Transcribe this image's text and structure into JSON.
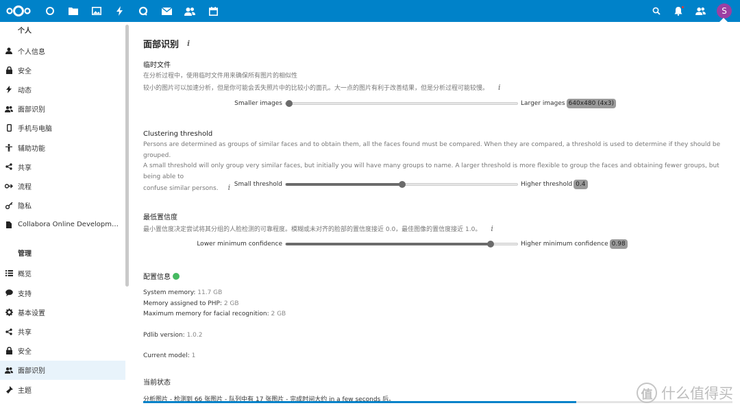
{
  "header": {
    "apps": [
      "dashboard",
      "files",
      "photos",
      "activity",
      "talk",
      "mail",
      "contacts",
      "calendar"
    ],
    "accent": "#0082c9",
    "avatar_letter": "S",
    "avatar_color": "#9b3fa3"
  },
  "sidebar": {
    "personal_heading": "个人",
    "personal_items": [
      {
        "label": "个人信息",
        "icon": "user-icon"
      },
      {
        "label": "安全",
        "icon": "lock-icon"
      },
      {
        "label": "动态",
        "icon": "activity-icon"
      },
      {
        "label": "面部识别",
        "icon": "group-icon"
      },
      {
        "label": "手机与电脑",
        "icon": "phone-icon"
      },
      {
        "label": "辅助功能",
        "icon": "accessibility-icon"
      },
      {
        "label": "共享",
        "icon": "share-icon"
      },
      {
        "label": "流程",
        "icon": "flow-icon"
      },
      {
        "label": "隐私",
        "icon": "privacy-icon"
      },
      {
        "label": "Collabora Online Development E...",
        "icon": "document-icon"
      }
    ],
    "admin_heading": "管理",
    "admin_items": [
      {
        "label": "概览",
        "icon": "overview-icon"
      },
      {
        "label": "支持",
        "icon": "support-icon"
      },
      {
        "label": "基本设置",
        "icon": "gear-icon"
      },
      {
        "label": "共享",
        "icon": "share-icon"
      },
      {
        "label": "安全",
        "icon": "lock-icon"
      },
      {
        "label": "面部识别",
        "icon": "group-icon",
        "active": true
      },
      {
        "label": "主题",
        "icon": "theme-icon"
      }
    ]
  },
  "main": {
    "title": "面部识别",
    "temp_files": {
      "title": "临时文件",
      "desc1": "在分析过程中，使用临时文件用来确保所有图片的相似性",
      "desc2": "较小的图片可以加速分析，但是你可能会丢失照片中的比较小的面孔。大一点的图片有利于改善结果，但是分析过程可能较慢。",
      "left_label": "Smaller images",
      "right_label": "Larger images",
      "badge": "640x480 (4x3)",
      "value": 0
    },
    "clustering": {
      "title": "Clustering threshold",
      "desc1": "Persons are determined as groups of similar faces and to obtain them, all the faces found must be compared. When they are compared, a threshold is used to determine if they should be grouped.",
      "desc2": "A small threshold will only group very similar faces, but initially you will have many groups to name. A larger threshold is more flexible to group the faces and obtaining fewer groups, but being able to",
      "desc3": "confuse similar persons.",
      "left_label": "Small threshold",
      "right_label": "Higher threshold",
      "badge": "0.4",
      "value": 0.5
    },
    "confidence": {
      "title": "最低置信度",
      "desc1": "最小置信度决定尝试将其分组的人脸检测的可靠程度。模糊或未对齐的脸部的置信度接近 0.0，最佳图像的置信度接近 1.0。",
      "left_label": "Lower minimum confidence",
      "right_label": "Higher minimum confidence",
      "badge": "0.98",
      "value": 0.88
    },
    "config": {
      "title": "配置信息",
      "status_color": "#46ba61",
      "system_memory_label": "System memory:",
      "system_memory": "11.7 GB",
      "php_memory_label": "Memory assigned to PHP:",
      "php_memory": "2 GB",
      "max_memory_label": "Maximum memory for facial recognition:",
      "max_memory": "2 GB",
      "pdlib_label": "Pdlib version:",
      "pdlib": "1.0.2",
      "model_label": "Current model:",
      "model": "1"
    },
    "status": {
      "title": "当前状态",
      "text": "分析图片 - 检测到 66 张图片 - 队列中有 17 张图片 - 完成时间大约 in a few seconds 后。",
      "progress": 0.735
    }
  },
  "watermark": {
    "glyph": "值",
    "text": "什么值得买"
  }
}
